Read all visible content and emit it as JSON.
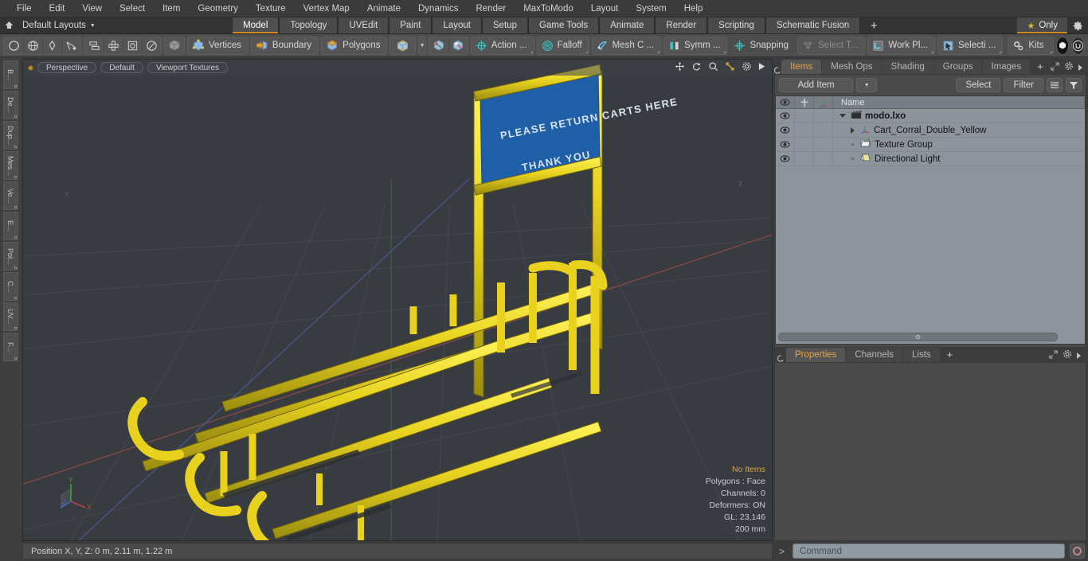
{
  "menubar": {
    "items": [
      "File",
      "Edit",
      "View",
      "Select",
      "Item",
      "Geometry",
      "Texture",
      "Vertex Map",
      "Animate",
      "Dynamics",
      "Render",
      "MaxToModo",
      "Layout",
      "System",
      "Help"
    ]
  },
  "layoutbar": {
    "home_icon": "home-icon",
    "layouts_label": "Default Layouts",
    "tabs": [
      {
        "label": "Model",
        "active": true
      },
      {
        "label": "Topology",
        "active": false
      },
      {
        "label": "UVEdit",
        "active": false
      },
      {
        "label": "Paint",
        "active": false
      },
      {
        "label": "Layout",
        "active": false
      },
      {
        "label": "Setup",
        "active": false
      },
      {
        "label": "Game Tools",
        "active": false
      },
      {
        "label": "Animate",
        "active": false
      },
      {
        "label": "Render",
        "active": false
      },
      {
        "label": "Scripting",
        "active": false
      },
      {
        "label": "Schematic Fusion",
        "active": false
      }
    ],
    "add_tab_label": "+",
    "only_label": "Only",
    "only_icon": "star-icon",
    "gear_icon": "gear-icon"
  },
  "toolbar": {
    "shape_tools": [
      "circle-icon",
      "globe-icon",
      "pen-icon",
      "curve-icon"
    ],
    "arrange_tools": [
      "mirror-icon",
      "array-icon",
      "center-icon",
      "radial-icon"
    ],
    "solid_icon": "cube-gray-icon",
    "selection_modes": [
      {
        "label": "Vertices",
        "icon": "vertices-icon"
      },
      {
        "label": "Boundary",
        "icon": "boundary-icon"
      },
      {
        "label": "Polygons",
        "icon": "polygons-icon"
      }
    ],
    "item_mode_icon": "cube-item-icon",
    "item_mode_drop": "chevron-down-icon",
    "pivot_icons": [
      "pivot-icon",
      "center-pivot-icon"
    ],
    "modifier_buttons": [
      {
        "label": "Action   ...",
        "icon": "action-center-icon",
        "dim": false
      },
      {
        "label": "Falloff",
        "icon": "falloff-icon",
        "dim": false
      },
      {
        "label": "Mesh C ...",
        "icon": "mesh-constraint-icon",
        "dim": false
      },
      {
        "label": "Symm ...",
        "icon": "symmetry-icon",
        "dim": false
      },
      {
        "label": "Snapping",
        "icon": "snapping-icon",
        "dim": false
      },
      {
        "label": "Select T...",
        "icon": "select-through-icon",
        "dim": true
      },
      {
        "label": "Work Pl...",
        "icon": "work-plane-icon",
        "dim": false
      },
      {
        "label": "Selecti ...",
        "icon": "selection-set-icon",
        "dim": false
      }
    ],
    "kits_label": "Kits",
    "kits_icon": "gears-icon",
    "app_icons": [
      "modo-icon",
      "unreal-icon"
    ]
  },
  "vstrip": {
    "tabs": [
      "B...",
      "De...",
      "Dup...",
      "Mes...",
      "Ve...",
      "E...",
      "Pol...",
      "C...",
      "UV...",
      "F..."
    ]
  },
  "viewport": {
    "pills": [
      "Perspective",
      "Default",
      "Viewport Textures"
    ],
    "nav_icons": [
      "pan-icon",
      "rotate-icon",
      "zoom-icon",
      "fit-icon",
      "gear-icon",
      "play-icon"
    ],
    "axis_labels": {
      "x": "X",
      "y": "Y",
      "z": "Z"
    },
    "far_labels": [
      "x",
      "z"
    ],
    "sign_text": [
      "PLEASE RETURN CARTS HERE",
      "THANK YOU"
    ],
    "stats": [
      {
        "text": "No Items",
        "highlight": true
      },
      {
        "text": "Polygons : Face",
        "highlight": false
      },
      {
        "text": "Channels: 0",
        "highlight": false
      },
      {
        "text": "Deformers: ON",
        "highlight": false
      },
      {
        "text": "GL: 23,146",
        "highlight": false
      },
      {
        "text": "200 mm",
        "highlight": false
      }
    ]
  },
  "right_panel": {
    "top_tabs": [
      {
        "label": "Items",
        "active": true
      },
      {
        "label": "Mesh Ops",
        "active": false
      },
      {
        "label": "Shading",
        "active": false
      },
      {
        "label": "Groups",
        "active": false
      },
      {
        "label": "Images",
        "active": false
      }
    ],
    "top_tabs_plus": "+",
    "expand_icon": "expand-icon",
    "gear_icon": "gear-icon",
    "more_icon": "chevron-right-icon",
    "add_item_label": "Add Item",
    "add_item_drop_icon": "chevron-down-icon",
    "select_label": "Select",
    "filter_label": "Filter",
    "list_icon": "list-options-icon",
    "funnel_icon": "funnel-icon",
    "tree_columns": [
      "eye-icon",
      "move-icon",
      "deform-icon",
      "Name"
    ],
    "tree_rows": [
      {
        "name": "modo.lxo",
        "icon": "scene-icon",
        "depth": 0,
        "expanded": true,
        "bold": true
      },
      {
        "name": "Cart_Corral_Double_Yellow",
        "icon": "mesh-axis-icon",
        "depth": 1,
        "expanded": false,
        "bold": false
      },
      {
        "name": "Texture Group",
        "icon": "texture-group-icon",
        "depth": 1,
        "expanded": null,
        "bold": false
      },
      {
        "name": "Directional Light",
        "icon": "light-icon",
        "depth": 1,
        "expanded": null,
        "bold": false
      }
    ],
    "bottom_tabs": [
      {
        "label": "Properties",
        "active": true
      },
      {
        "label": "Channels",
        "active": false
      },
      {
        "label": "Lists",
        "active": false
      }
    ],
    "bottom_tabs_plus": "+"
  },
  "bottom_bar": {
    "status_text": "Position X, Y, Z:   0 m, 2.11 m, 1.22 m",
    "command_prompt": ">",
    "command_placeholder": "Command",
    "record_icon": "record-icon"
  },
  "colors": {
    "accent": "#e8a33d",
    "tab_underline": "#d08a28",
    "model_yellow": "#e8d21e",
    "sign_blue": "#1f5fa8",
    "viewport_bg": "#383c41",
    "axis_x": "#b44444",
    "axis_y": "#3f9e3f",
    "axis_z": "#4466c0"
  }
}
